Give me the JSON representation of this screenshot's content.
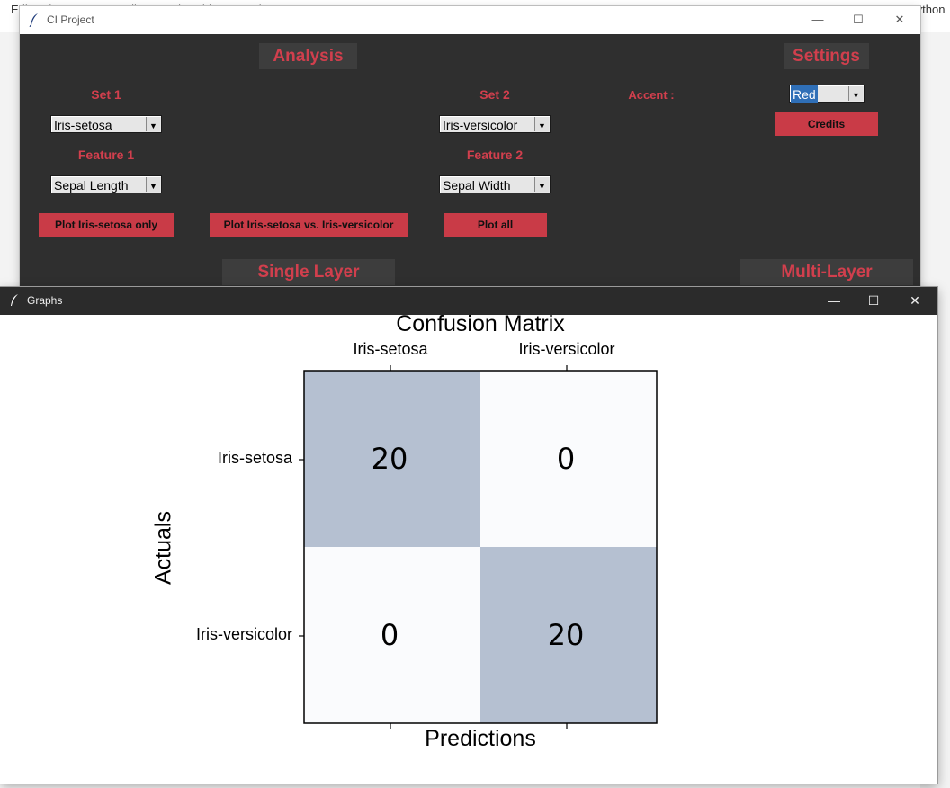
{
  "main_window": {
    "title": "CI Project",
    "analysis": {
      "heading": "Analysis",
      "set1_label": "Set 1",
      "set1_value": "Iris-setosa",
      "feature1_label": "Feature 1",
      "feature1_value": "Sepal Length",
      "set2_label": "Set 2",
      "set2_value": "Iris-versicolor",
      "feature2_label": "Feature 2",
      "feature2_value": "Sepal Width",
      "plot_set1_button": "Plot Iris-setosa only",
      "plot_vs_button": "Plot Iris-setosa vs. Iris-versicolor",
      "plot_all_button": "Plot all"
    },
    "settings": {
      "heading": "Settings",
      "accent_label": "Accent :",
      "accent_value": "Red",
      "credits_button": "Credits"
    },
    "single_layer_heading": "Single Layer",
    "multi_layer_heading": "Multi-Layer"
  },
  "graph_window": {
    "title": "Graphs"
  },
  "colors": {
    "accent": "#c93b47",
    "accent_text": "#d13f4d",
    "panel_bg": "#2f2f2f",
    "cell_high": "#b5c0d1",
    "cell_low": "#fafbfd"
  },
  "chart_data": {
    "type": "heatmap",
    "title": "Confusion Matrix",
    "xlabel": "Predictions",
    "ylabel": "Actuals",
    "x_categories": [
      "Iris-setosa",
      "Iris-versicolor"
    ],
    "y_categories": [
      "Iris-setosa",
      "Iris-versicolor"
    ],
    "values": [
      [
        20,
        0
      ],
      [
        0,
        20
      ]
    ],
    "x_tick_position": "top"
  }
}
